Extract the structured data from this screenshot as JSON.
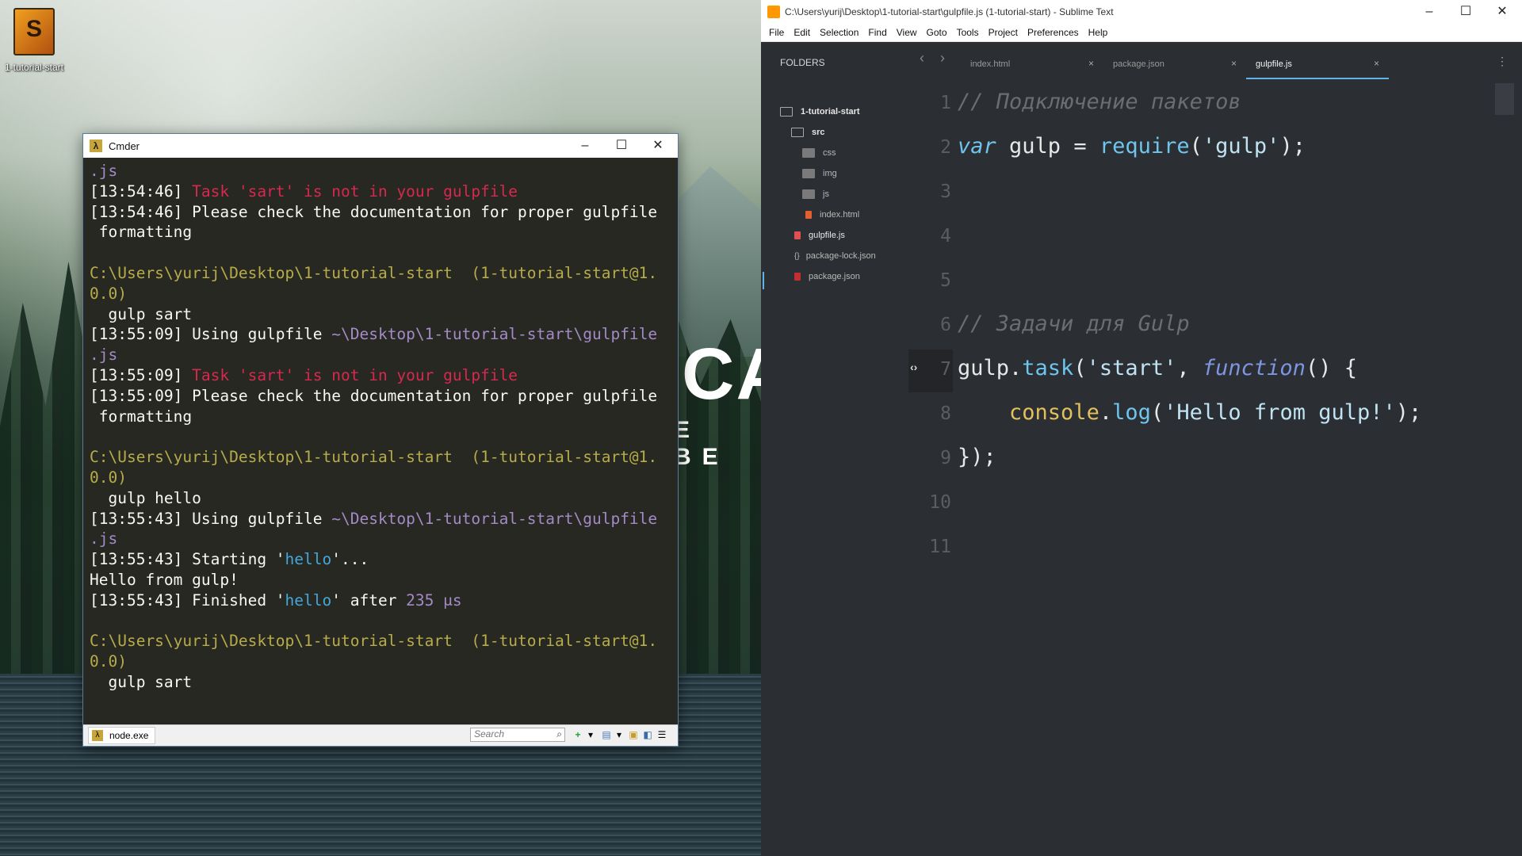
{
  "desktop": {
    "icon_label": "1-tutorial-start",
    "wallpaper_title": "CAD",
    "wallpaper_subtitle": "E BE"
  },
  "cmder": {
    "title": "Cmder",
    "window_controls": {
      "minimize": "–",
      "maximize": "☐",
      "close": "✕"
    },
    "console_lines": [
      [
        {
          "t": ".js",
          "c": "c-purple"
        }
      ],
      [
        {
          "t": "[13:54:46] ",
          "c": ""
        },
        {
          "t": "Task 'sart' is not in your gulpfile",
          "c": "c-red"
        }
      ],
      [
        {
          "t": "[13:54:46] Please check the documentation for proper gulpfile",
          "c": ""
        }
      ],
      [
        {
          "t": " formatting",
          "c": ""
        }
      ],
      [
        {
          "t": "",
          "c": ""
        }
      ],
      [
        {
          "t": "C:\\Users\\yurij\\Desktop\\1-tutorial-start  (1-tutorial-start@1.",
          "c": "c-olive"
        }
      ],
      [
        {
          "t": "0.0)",
          "c": "c-olive"
        }
      ],
      [
        {
          "t": "  gulp sart",
          "c": ""
        }
      ],
      [
        {
          "t": "[13:55:09] Using gulpfile ",
          "c": ""
        },
        {
          "t": "~\\Desktop\\1-tutorial-start\\gulpfile",
          "c": "c-purple"
        }
      ],
      [
        {
          "t": ".js",
          "c": "c-purple"
        }
      ],
      [
        {
          "t": "[13:55:09] ",
          "c": ""
        },
        {
          "t": "Task 'sart' is not in your gulpfile",
          "c": "c-red"
        }
      ],
      [
        {
          "t": "[13:55:09] Please check the documentation for proper gulpfile",
          "c": ""
        }
      ],
      [
        {
          "t": " formatting",
          "c": ""
        }
      ],
      [
        {
          "t": "",
          "c": ""
        }
      ],
      [
        {
          "t": "C:\\Users\\yurij\\Desktop\\1-tutorial-start  (1-tutorial-start@1.",
          "c": "c-olive"
        }
      ],
      [
        {
          "t": "0.0)",
          "c": "c-olive"
        }
      ],
      [
        {
          "t": "  gulp hello",
          "c": ""
        }
      ],
      [
        {
          "t": "[13:55:43] Using gulpfile ",
          "c": ""
        },
        {
          "t": "~\\Desktop\\1-tutorial-start\\gulpfile",
          "c": "c-purple"
        }
      ],
      [
        {
          "t": ".js",
          "c": "c-purple"
        }
      ],
      [
        {
          "t": "[13:55:43] Starting '",
          "c": ""
        },
        {
          "t": "hello",
          "c": "c-blue"
        },
        {
          "t": "'...",
          "c": ""
        }
      ],
      [
        {
          "t": "Hello from gulp!",
          "c": ""
        }
      ],
      [
        {
          "t": "[13:55:43] Finished '",
          "c": ""
        },
        {
          "t": "hello",
          "c": "c-blue"
        },
        {
          "t": "' after ",
          "c": ""
        },
        {
          "t": "235 μs",
          "c": "c-purple"
        }
      ],
      [
        {
          "t": "",
          "c": ""
        }
      ],
      [
        {
          "t": "C:\\Users\\yurij\\Desktop\\1-tutorial-start  (1-tutorial-start@1.",
          "c": "c-olive"
        }
      ],
      [
        {
          "t": "0.0)",
          "c": "c-olive"
        }
      ],
      [
        {
          "t": "  gulp sart",
          "c": ""
        }
      ]
    ],
    "status": {
      "tab_label": "node.exe",
      "search_placeholder": "Search"
    }
  },
  "sublime": {
    "title": "C:\\Users\\yurij\\Desktop\\1-tutorial-start\\gulpfile.js (1-tutorial-start) - Sublime Text",
    "menu": [
      "File",
      "Edit",
      "Selection",
      "Find",
      "View",
      "Goto",
      "Tools",
      "Project",
      "Preferences",
      "Help"
    ],
    "sidebar": {
      "heading": "FOLDERS",
      "items": [
        {
          "label": "1-tutorial-start",
          "icon": "folder-open-icon"
        },
        {
          "label": "src",
          "icon": "folder-open-icon"
        },
        {
          "label": "css",
          "icon": "folder-icon"
        },
        {
          "label": "img",
          "icon": "folder-icon"
        },
        {
          "label": "js",
          "icon": "folder-icon"
        },
        {
          "label": "index.html",
          "icon": "html-file-icon"
        },
        {
          "label": "gulpfile.js",
          "icon": "js-file-icon"
        },
        {
          "label": "package-lock.json",
          "icon": "json-file-icon"
        },
        {
          "label": "package.json",
          "icon": "npm-file-icon"
        }
      ]
    },
    "tabs": [
      {
        "label": "index.html",
        "active": false
      },
      {
        "label": "package.json",
        "active": false
      },
      {
        "label": "gulpfile.js",
        "active": true
      }
    ],
    "code": [
      [
        {
          "t": "// Подключение пакетов",
          "c": "k-comment"
        }
      ],
      [
        {
          "t": "var",
          "c": "k-var"
        },
        {
          "t": " gulp = ",
          "c": "k-plain"
        },
        {
          "t": "require",
          "c": "k-fn"
        },
        {
          "t": "(",
          "c": "k-plain"
        },
        {
          "t": "'gulp'",
          "c": "k-str"
        },
        {
          "t": ");",
          "c": "k-plain"
        }
      ],
      [],
      [],
      [],
      [
        {
          "t": "// Задачи для Gulp",
          "c": "k-comment"
        }
      ],
      [
        {
          "t": "gulp.",
          "c": "k-plain"
        },
        {
          "t": "task",
          "c": "k-fn"
        },
        {
          "t": "(",
          "c": "k-plain"
        },
        {
          "t": "'start'",
          "c": "k-str"
        },
        {
          "t": ", ",
          "c": "k-plain"
        },
        {
          "t": "function",
          "c": "k-func"
        },
        {
          "t": "() {",
          "c": "k-plain"
        }
      ],
      [
        {
          "t": "    ",
          "c": "k-plain"
        },
        {
          "t": "console",
          "c": "k-obj"
        },
        {
          "t": ".",
          "c": "k-plain"
        },
        {
          "t": "log",
          "c": "k-fn"
        },
        {
          "t": "(",
          "c": "k-plain"
        },
        {
          "t": "'Hello from gulp!'",
          "c": "k-str"
        },
        {
          "t": ");",
          "c": "k-plain"
        }
      ],
      [
        {
          "t": "});",
          "c": "k-plain"
        }
      ],
      [],
      []
    ],
    "line_numbers": [
      "1",
      "2",
      "3",
      "4",
      "5",
      "6",
      "7",
      "8",
      "9",
      "10",
      "11"
    ]
  }
}
